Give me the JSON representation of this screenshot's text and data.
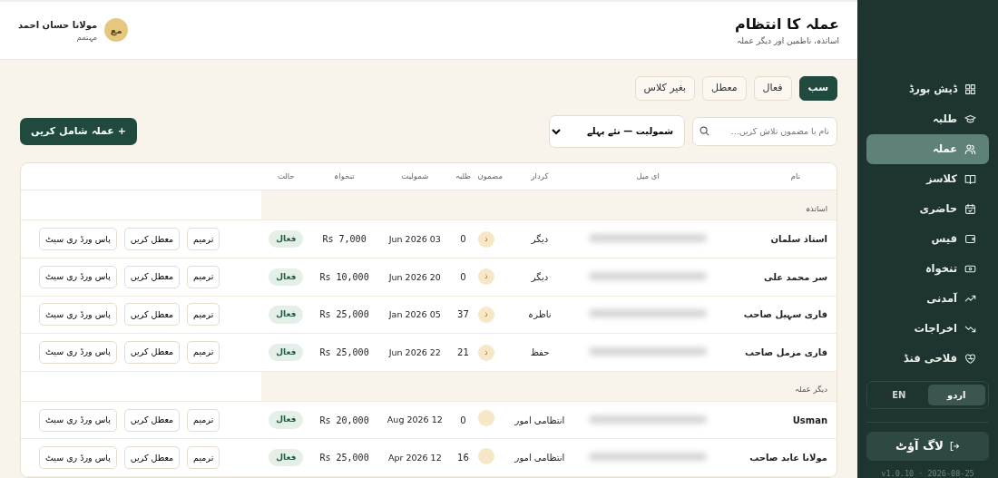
{
  "sidebar": {
    "items": [
      {
        "label": "ڈیش بورڈ",
        "selected": false
      },
      {
        "label": "طلبہ",
        "selected": false
      },
      {
        "label": "عملہ",
        "selected": true
      },
      {
        "label": "کلاسز",
        "selected": false
      },
      {
        "label": "حاضری",
        "selected": false
      },
      {
        "label": "فیس",
        "selected": false
      },
      {
        "label": "تنخواہ",
        "selected": false
      },
      {
        "label": "آمدنی",
        "selected": false
      },
      {
        "label": "اخراجات",
        "selected": false
      },
      {
        "label": "فلاحی فنڈ",
        "selected": false
      }
    ],
    "languages": [
      {
        "label": "اردو",
        "selected": true
      },
      {
        "label": "EN",
        "selected": false
      }
    ],
    "logout": "لاگ آؤٹ",
    "version": "v1.0.10 · 2026-08-25"
  },
  "header": {
    "title": "عملہ کا انتظام",
    "subtitle": "اساتذہ، ناظمین اور دیگر عملہ",
    "user": {
      "avatar": "مع",
      "name": "مولانا حسان احمد",
      "role": "مہتمم"
    }
  },
  "tabs": [
    {
      "label": "سب",
      "selected": true
    },
    {
      "label": "فعال",
      "selected": false
    },
    {
      "label": "معطل",
      "selected": false
    },
    {
      "label": "بغیر کلاس",
      "selected": false
    }
  ],
  "search": {
    "placeholder": "نام یا مضمون تلاش کریں..."
  },
  "sort": {
    "value": "شمولیت — نئے پہلے"
  },
  "add_button": "+ عملہ شامل کریں",
  "table": {
    "columns": [
      "نام",
      "ای میل",
      "کردار",
      "مضمون",
      "طلبہ",
      "شمولیت",
      "تنخواہ",
      "حالت"
    ],
    "groups": [
      {
        "title": "اساتذہ",
        "rows": [
          {
            "name": "استاذ سلمان",
            "subject": "ذ",
            "role": "دیگر",
            "students": "0",
            "joined": "03 Jun 2026",
            "salary": "Rs 7,000",
            "status": "فعال",
            "active": true,
            "actions": [
              "ترمیم",
              "معطل کریں",
              "پاس ورڈ ری سیٹ"
            ]
          },
          {
            "name": "سر محمد علی",
            "subject": "ذ",
            "role": "دیگر",
            "students": "0",
            "joined": "20 Jun 2026",
            "salary": "Rs 10,000",
            "status": "فعال",
            "active": true,
            "actions": [
              "ترمیم",
              "معطل کریں",
              "پاس ورڈ ری سیٹ"
            ]
          },
          {
            "name": "قاری سہیل صاحب",
            "subject": "ذ",
            "role": "ناظرہ",
            "students": "37",
            "joined": "05 Jan 2026",
            "salary": "Rs 25,000",
            "status": "فعال",
            "active": true,
            "actions": [
              "ترمیم",
              "معطل کریں",
              "پاس ورڈ ری سیٹ"
            ]
          },
          {
            "name": "قاری مزمل صاحب",
            "subject": "ذ",
            "role": "حفظ",
            "students": "21",
            "joined": "22 Jun 2026",
            "salary": "Rs 25,000",
            "status": "فعال",
            "active": true,
            "actions": [
              "ترمیم",
              "معطل کریں",
              "پاس ورڈ ری سیٹ"
            ]
          }
        ]
      },
      {
        "title": "دیگر عملہ",
        "rows": [
          {
            "name": "Usman",
            "role": "انتظامی امور",
            "students": "0",
            "joined": "12 Aug 2026",
            "salary": "Rs 20,000",
            "status": "فعال",
            "active": true,
            "actions": [
              "ترمیم",
              "معطل کریں",
              "پاس ورڈ ری سیٹ"
            ]
          },
          {
            "name": "مولانا عابد صاحب",
            "role": "انتظامی امور",
            "students": "16",
            "joined": "12 Apr 2026",
            "salary": "Rs 25,000",
            "status": "فعال",
            "active": true,
            "actions": [
              "ترمیم",
              "معطل کریں",
              "پاس ورڈ ری سیٹ"
            ]
          }
        ]
      }
    ]
  }
}
